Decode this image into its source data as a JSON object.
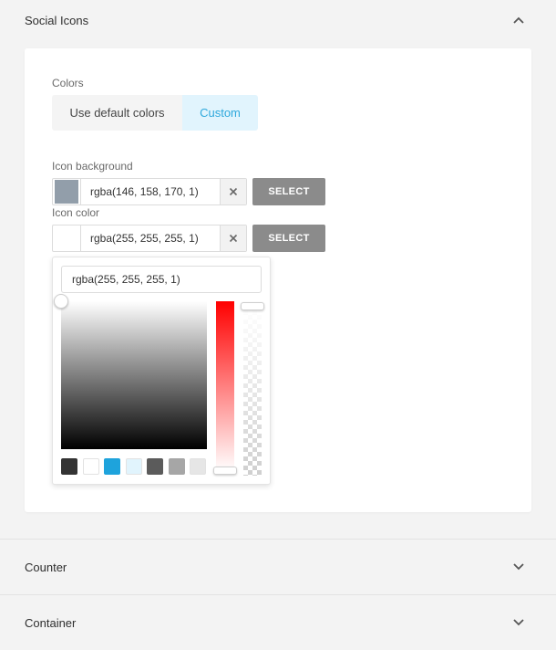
{
  "sections": {
    "social_icons": {
      "title": "Social Icons",
      "icon": "chevron-up-icon"
    },
    "counter": {
      "title": "Counter",
      "icon": "chevron-down-icon"
    },
    "container": {
      "title": "Container",
      "icon": "chevron-down-icon"
    }
  },
  "colors": {
    "label": "Colors",
    "options": [
      "Use default colors",
      "Custom"
    ],
    "selected": "Custom"
  },
  "icon_background": {
    "label": "Icon background",
    "value": "rgba(146, 158, 170, 1)",
    "swatch": "#929eaa",
    "select_label": "SELECT"
  },
  "icon_color": {
    "label": "Icon color",
    "value": "rgba(255, 255, 255, 1)",
    "swatch": "#ffffff",
    "select_label": "SELECT"
  },
  "picker": {
    "value": "rgba(255, 255, 255, 1)",
    "hue_color": "#ff0000",
    "presets": [
      "#333333",
      "#ffffff",
      "#1ea3dc",
      "#e1f4fd",
      "#5b5b5b",
      "#a6a6a6",
      "#e6e6e6"
    ]
  }
}
